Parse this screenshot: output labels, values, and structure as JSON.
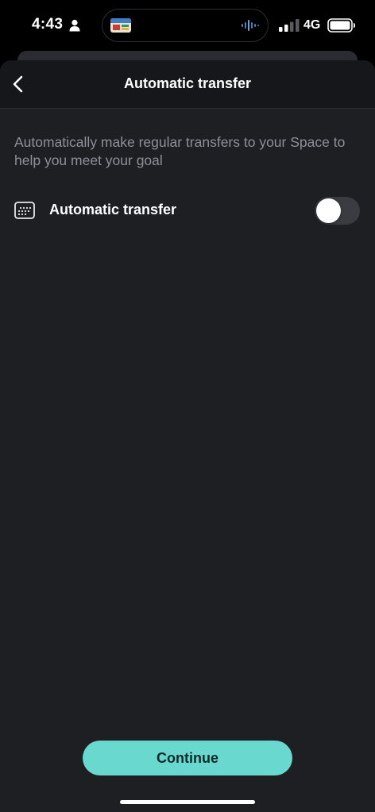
{
  "status_bar": {
    "time": "4:43",
    "network": "4G",
    "icons": [
      "person-icon",
      "app-icon",
      "waveform-icon",
      "signal-icon",
      "battery-icon"
    ]
  },
  "nav": {
    "title": "Automatic transfer",
    "back_icon": "chevron-left-icon"
  },
  "main": {
    "description": "Automatically make regular transfers to your Space to help you meet your goal",
    "setting": {
      "label": "Automatic transfer",
      "icon": "calendar-icon",
      "enabled": false
    }
  },
  "footer": {
    "continue_label": "Continue"
  },
  "colors": {
    "accent": "#69d9d0",
    "background": "#1e1f23",
    "nav_background": "#16171a",
    "secondary_text": "#8d9099",
    "toggle_off": "#3a3c41"
  }
}
